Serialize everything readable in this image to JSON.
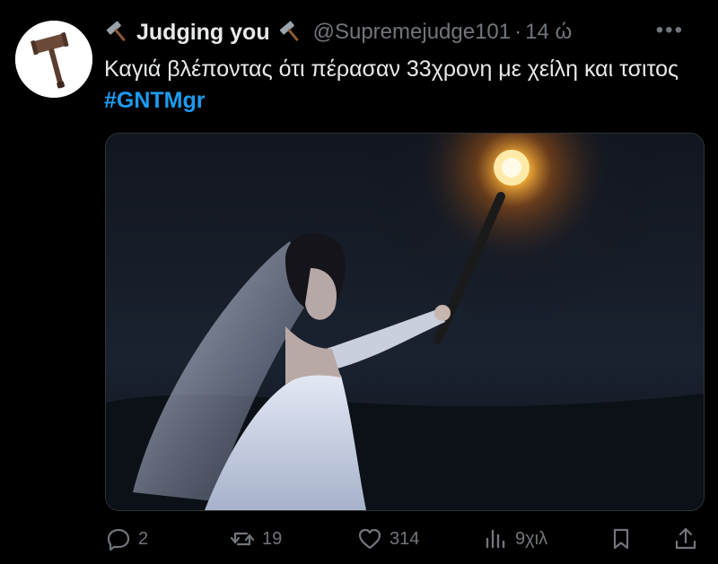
{
  "author": {
    "display_name": "Judging you",
    "handle": "@Supremejudge101",
    "separator": "·",
    "time": "14 ώ"
  },
  "tweet": {
    "text_main": "Καγιά βλέποντας ότι πέρασαν 33χρονη με χείλη και τσιτος ",
    "hashtag": "#GNTMgr"
  },
  "actions": {
    "replies": "2",
    "retweets": "19",
    "likes": "314",
    "views": "9χιλ"
  },
  "icons": {
    "avatar": "gavel-icon",
    "name_prefix": "hammer-icon",
    "name_suffix": "hammer-icon",
    "more": "more-dots-icon",
    "reply": "reply-icon",
    "retweet": "retweet-icon",
    "like": "heart-icon",
    "views": "views-icon",
    "bookmark": "bookmark-icon",
    "share": "share-icon"
  },
  "colors": {
    "background": "#000000",
    "text": "#e7e9ea",
    "muted": "#71767b",
    "hashtag": "#1d9bf0"
  }
}
